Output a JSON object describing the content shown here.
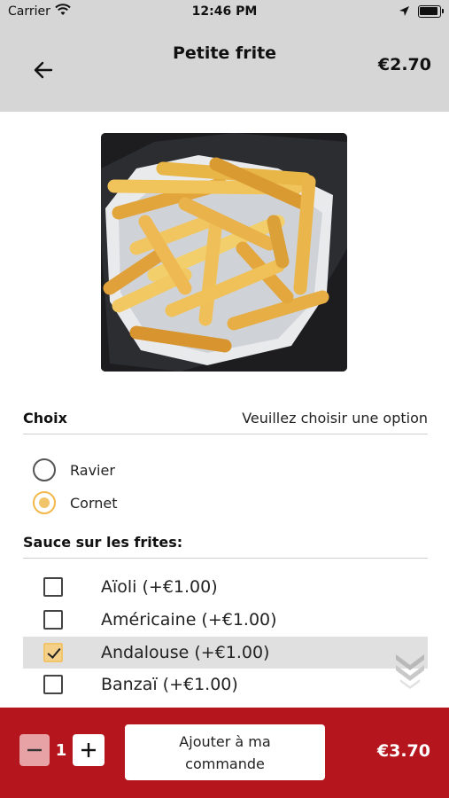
{
  "status_bar": {
    "carrier": "Carrier",
    "time": "12:46 PM"
  },
  "header": {
    "title": "Petite frite",
    "price": "€2.70"
  },
  "product_image": {
    "alt": "Petite frite"
  },
  "choice_section": {
    "label": "Choix",
    "hint": "Veuillez choisir une option",
    "options": [
      {
        "label": "Ravier",
        "selected": false
      },
      {
        "label": "Cornet",
        "selected": true
      }
    ]
  },
  "sauce_section": {
    "label": "Sauce sur les frites:",
    "items": [
      {
        "label": "Aïoli (+€1.00)",
        "checked": false
      },
      {
        "label": "Américaine (+€1.00)",
        "checked": false
      },
      {
        "label": "Andalouse (+€1.00)",
        "checked": true
      },
      {
        "label": "Banzaï (+€1.00)",
        "checked": false
      }
    ]
  },
  "footer": {
    "quantity": "1",
    "add_label": "Ajouter à ma commande",
    "total": "€3.70"
  },
  "colors": {
    "header_bg": "#d6d6d6",
    "footer_bg": "#b5161d",
    "accent": "#f2c46a",
    "selected_row_bg": "#e0e0e0"
  }
}
